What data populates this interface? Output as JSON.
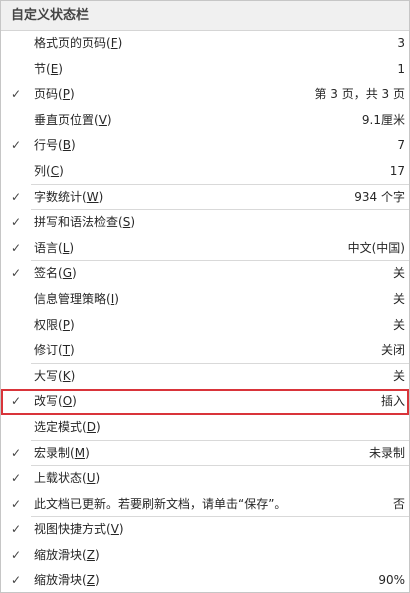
{
  "menu": {
    "title": "自定义状态栏",
    "items": [
      {
        "checked": false,
        "text": "格式页的页码",
        "key": "F",
        "value": "3",
        "sep": false
      },
      {
        "checked": false,
        "text": "节",
        "key": "E",
        "value": "1",
        "sep": false
      },
      {
        "checked": true,
        "text": "页码",
        "key": "P",
        "value": "第 3 页，共 3 页",
        "sep": false
      },
      {
        "checked": false,
        "text": "垂直页位置",
        "key": "V",
        "value": "9.1厘米",
        "sep": false
      },
      {
        "checked": true,
        "text": "行号",
        "key": "B",
        "value": "7",
        "sep": false
      },
      {
        "checked": false,
        "text": "列",
        "key": "C",
        "value": "17",
        "sep": true
      },
      {
        "checked": true,
        "text": "字数统计",
        "key": "W",
        "value": "934 个字",
        "sep": true
      },
      {
        "checked": true,
        "text": "拼写和语法检查",
        "key": "S",
        "value": "",
        "sep": false
      },
      {
        "checked": true,
        "text": "语言",
        "key": "L",
        "value": "中文(中国)",
        "sep": true
      },
      {
        "checked": true,
        "text": "签名",
        "key": "G",
        "value": "关",
        "sep": false
      },
      {
        "checked": false,
        "text": "信息管理策略",
        "key": "I",
        "value": "关",
        "sep": false
      },
      {
        "checked": false,
        "text": "权限",
        "key": "P",
        "value": "关",
        "sep": false
      },
      {
        "checked": false,
        "text": "修订",
        "key": "T",
        "value": "关闭",
        "sep": true
      },
      {
        "checked": false,
        "text": "大写",
        "key": "K",
        "value": "关",
        "sep": false
      },
      {
        "checked": true,
        "text": "改写",
        "key": "O",
        "value": "插入",
        "sep": false,
        "highlight": true
      },
      {
        "checked": false,
        "text": "选定模式",
        "key": "D",
        "value": "",
        "sep": true
      },
      {
        "checked": true,
        "text": "宏录制",
        "key": "M",
        "value": "未录制",
        "sep": true
      },
      {
        "checked": true,
        "text": "上载状态",
        "key": "U",
        "value": "",
        "sep": false
      },
      {
        "checked": true,
        "text": "此文档已更新。若要刷新文档，请单击“保存”。",
        "key": "",
        "value": "否",
        "sep": true
      },
      {
        "checked": true,
        "text": "视图快捷方式",
        "key": "V",
        "value": "",
        "sep": false
      },
      {
        "checked": true,
        "text": "缩放滑块",
        "key": "Z",
        "value": "",
        "sep": false
      },
      {
        "checked": true,
        "text": "缩放滑块",
        "key": "Z",
        "value": "90%",
        "sep": false
      }
    ]
  },
  "icons": {
    "check": "checkmark-icon"
  },
  "colors": {
    "highlight_border": "#d9343a",
    "title_bg": "#f0f0f0"
  }
}
